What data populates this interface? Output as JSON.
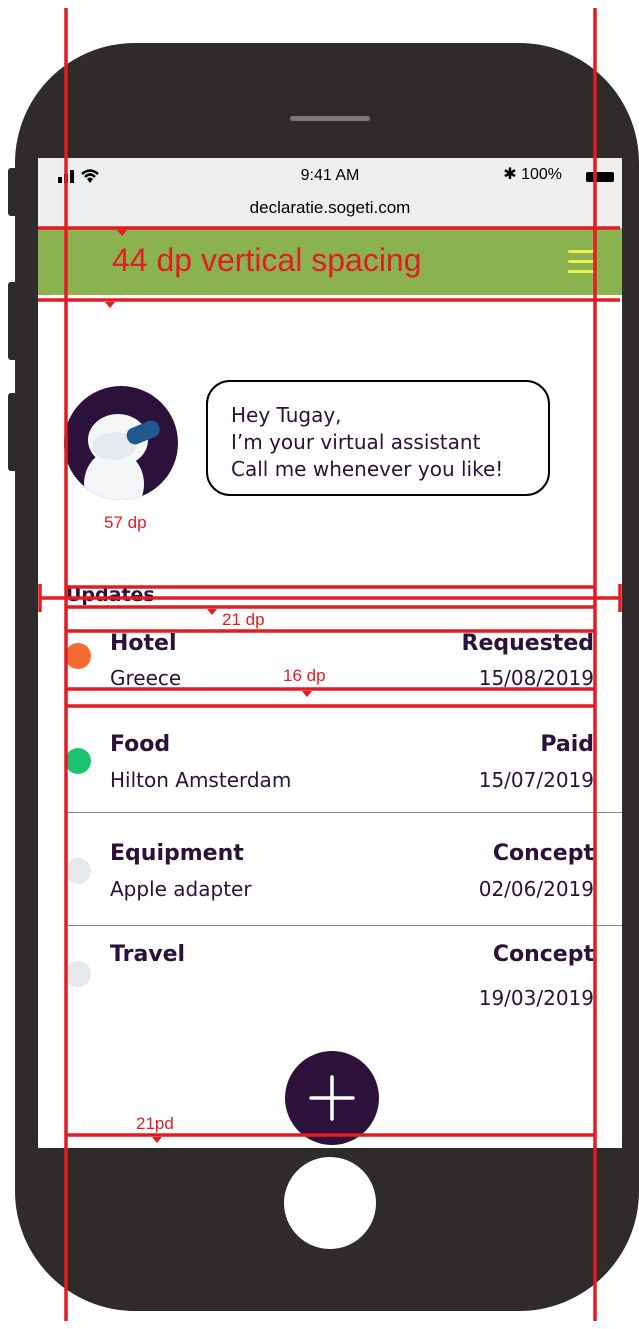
{
  "status_bar": {
    "time": "9:41 AM",
    "battery": "100%"
  },
  "browser": {
    "url": "declaratie.sogeti.com"
  },
  "header": {
    "title": "44 dp vertical spacing"
  },
  "assistant": {
    "lines": [
      "Hey Tugay,",
      "I’m your virtual assistant",
      "Call me whenever you like!"
    ]
  },
  "updates": {
    "title": "Updates",
    "items": [
      {
        "category": "Hotel",
        "place": "Greece",
        "status": "Requested",
        "date": "15/08/2019",
        "color": "#f36b2e"
      },
      {
        "category": "Food",
        "place": "Hilton Amsterdam",
        "status": "Paid",
        "date": "15/07/2019",
        "color": "#1ec36f"
      },
      {
        "category": "Equipment",
        "place": "Apple adapter",
        "status": "Concept",
        "date": "02/06/2019",
        "color": "#e7e7ec"
      },
      {
        "category": "Travel",
        "place": "",
        "status": "Concept",
        "date": "19/03/2019",
        "color": "#e7e7ec"
      }
    ]
  },
  "annotations": {
    "a57": "57 dp",
    "a21": "21 dp",
    "a16": "16 dp",
    "a21pd": "21pd"
  },
  "colors": {
    "accent": "#8ab34f",
    "primary": "#2c113a",
    "guide": "#e31c23"
  }
}
